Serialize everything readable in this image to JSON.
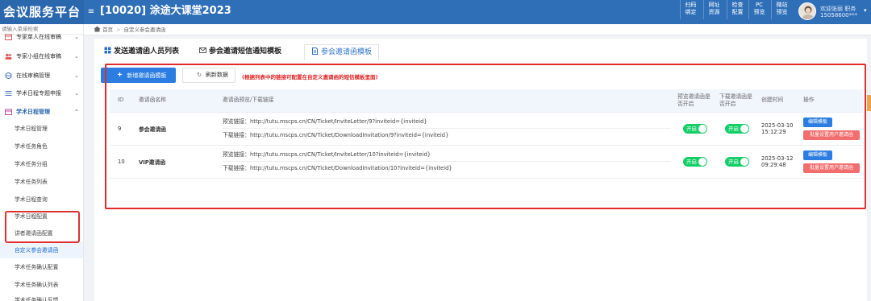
{
  "header": {
    "brand": "会议服务平台",
    "menu_toggle_icon": "hamburger-icon",
    "conference_title": "[10020] 涂途大课堂2023",
    "tools": [
      {
        "line1": "扫码",
        "line2": "绑定"
      },
      {
        "line1": "网址",
        "line2": "资源"
      },
      {
        "line1": "检查",
        "line2": "配置"
      },
      {
        "line1": "PC",
        "line2": "预览"
      },
      {
        "line1": "微站",
        "line2": "预览"
      }
    ],
    "user": {
      "name": "欢迎张丽 职务",
      "phone": "15058600***",
      "caret_icon": "caret-down-icon"
    }
  },
  "sidebar": {
    "search_placeholder": "请输入菜单检索",
    "groups": [
      {
        "label": "专家单人在线审稿",
        "icon": "calendar-icon"
      },
      {
        "label": "专家小组在线审稿",
        "icon": "users-icon"
      },
      {
        "label": "在线审稿管理",
        "icon": "globe-icon"
      },
      {
        "label": "学术日程专题申报",
        "icon": "list-icon"
      },
      {
        "label": "学术日程管理",
        "icon": "calendar-icon"
      }
    ],
    "sub_items": [
      "学术日程管理",
      "学术任务角色",
      "学术任务分组",
      "学术任务列表",
      "学术日程查询",
      "学术日程配置",
      "讲者邀请函配置",
      "自定义参会邀请函",
      "学术任务确认配置",
      "学术任务确认列表",
      "学术任务确认反馈"
    ]
  },
  "breadcrumb": {
    "home": "首页",
    "current": "自定义参会邀请函"
  },
  "tabs": [
    {
      "label": "发送邀请函人员列表",
      "icon": "grid-icon"
    },
    {
      "label": "参会邀请短信通知模板",
      "icon": "mail-icon"
    },
    {
      "label": "参会邀请函模板",
      "icon": "document-icon"
    }
  ],
  "toolbar": {
    "add_label": "新增邀请函模板",
    "refresh_label": "刷新数据",
    "tip": "(根据列表中的链接可配置在自定义邀请函的短信模板里面)"
  },
  "table": {
    "headers": {
      "id": "ID",
      "name": "邀请函名称",
      "links": "邀请函预览/下载链接",
      "preview_enabled": "预览邀请函是否开启",
      "download_enabled": "下载邀请函是否开启",
      "created": "创建时间",
      "actions": "操作"
    },
    "rows": [
      {
        "id": "9",
        "name": "参会邀请函",
        "preview_link": "预览链接：http://tutu.mscps.cn/CN/Ticket/InviteLetter/9?inviteid={inviteid}",
        "download_link": "下载链接：http://tutu.mscps.cn/CN/Ticket/DownloadInvitation/9?inviteid={inviteid}",
        "preview_toggle": "开启",
        "download_toggle": "开启",
        "created_date": "2025-03-10",
        "created_time": "15:12:29",
        "edit_label": "编辑模板",
        "batch_label": "批量设置用户邀请函"
      },
      {
        "id": "10",
        "name": "VIP邀请函",
        "preview_link": "预览链接：http://tutu.mscps.cn/CN/Ticket/InviteLetter/10?inviteid={inviteid}",
        "download_link": "下载链接：http://tutu.mscps.cn/CN/Ticket/DownloadInvitation/10?inviteid={inviteid}",
        "preview_toggle": "开启",
        "download_toggle": "开启",
        "created_date": "2025-03-12",
        "created_time": "09:29:48",
        "edit_label": "编辑模板",
        "batch_label": "批量设置用户邀请函"
      }
    ]
  },
  "colors": {
    "header": "#2e6fb8",
    "primary": "#2b7de1",
    "danger": "#f26d6d",
    "toggle_on": "#13ce66",
    "highlight_outline": "#e02b2b"
  }
}
